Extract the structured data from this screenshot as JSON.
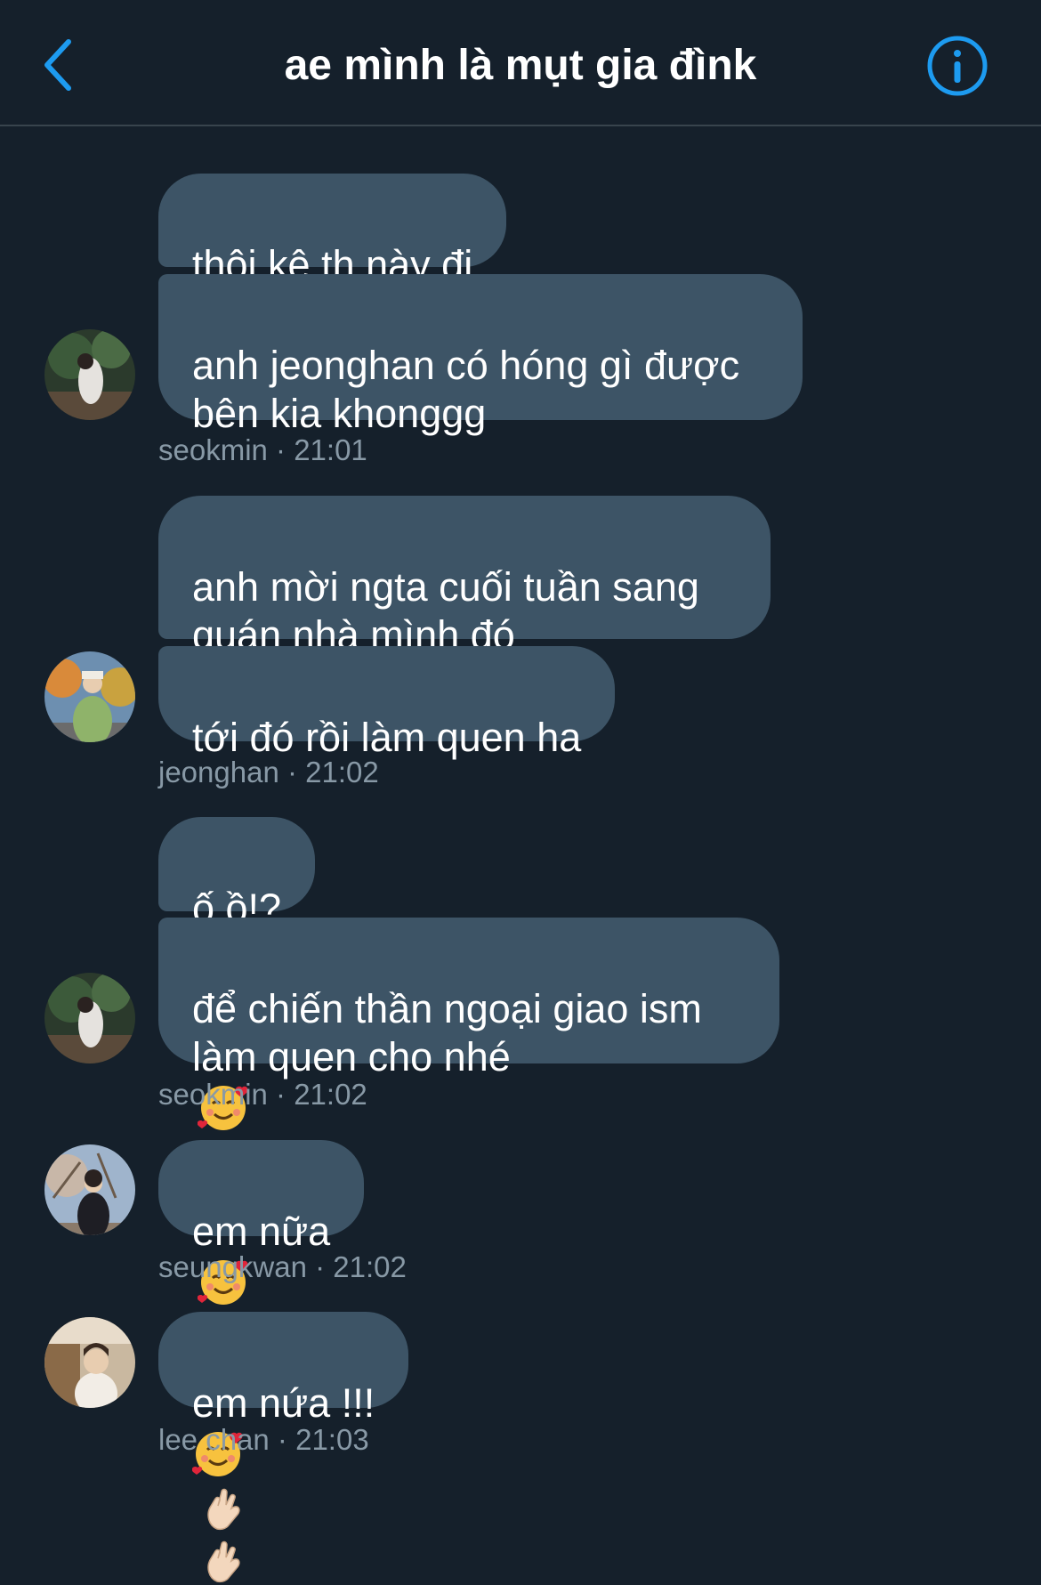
{
  "header": {
    "title": "ae mình là mụt gia đìnk",
    "back_icon": "chevron-left-icon",
    "info_icon": "info-circle-icon",
    "accent": "#1d9bf0"
  },
  "colors": {
    "background": "#15202b",
    "bubble": "#3d5466",
    "meta_text": "#8899a6"
  },
  "messages": [
    {
      "text": "thôi kệ th này đi"
    },
    {
      "text": "anh jeonghan có hóng gì được\nbên kia khonggg"
    },
    {
      "meta": "seokmin · 21:01"
    },
    {
      "text": "anh mời ngta cuối tuần sang\nquán nhà mình đó"
    },
    {
      "text": "tới đó rồi làm quen ha"
    },
    {
      "meta": "jeonghan · 21:02"
    },
    {
      "text": "ố ồ!?"
    },
    {
      "text": "để chiến thần ngoại giao ism\nlàm quen cho nhé"
    },
    {
      "meta": "seokmin · 21:02"
    },
    {
      "text": "em nữa"
    },
    {
      "meta": "seungkwan · 21:02"
    },
    {
      "text": "em nứa !!!"
    },
    {
      "meta": "lee chan · 21:03"
    }
  ],
  "emoji_icons": [
    "smiling-face-with-hearts-icon",
    "ok-hand-icon"
  ]
}
